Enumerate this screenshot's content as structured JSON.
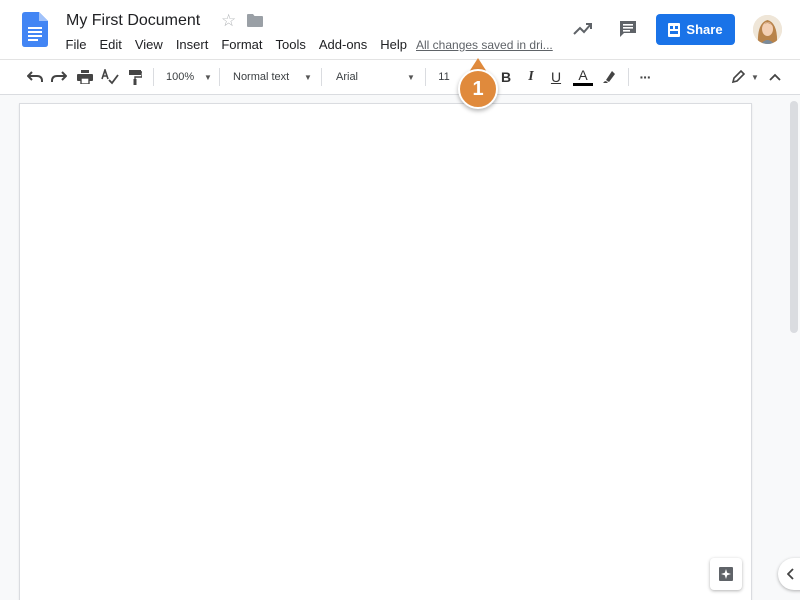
{
  "document": {
    "title": "My First Document",
    "saved_status": "All changes saved in dri..."
  },
  "menu": [
    "File",
    "Edit",
    "View",
    "Insert",
    "Format",
    "Tools",
    "Add-ons",
    "Help"
  ],
  "header": {
    "share_label": "Share"
  },
  "toolbar": {
    "zoom": "100%",
    "style": "Normal text",
    "font": "Arial",
    "size": "11",
    "bold": "B",
    "italic": "I",
    "underline": "U",
    "text_color": "A",
    "more": "···"
  },
  "callout": {
    "number": "1"
  },
  "colors": {
    "brand_blue": "#1a73e8",
    "callout_orange": "#e08a3c",
    "docs_blue": "#4285f4"
  },
  "icons": [
    "docs-logo-icon",
    "star-icon",
    "folder-icon",
    "trend-icon",
    "comment-icon",
    "lock-icon",
    "undo-icon",
    "redo-icon",
    "print-icon",
    "spellcheck-icon",
    "paint-format-icon",
    "highlight-icon",
    "edit-mode-icon",
    "explore-icon",
    "chevron-left-icon"
  ]
}
